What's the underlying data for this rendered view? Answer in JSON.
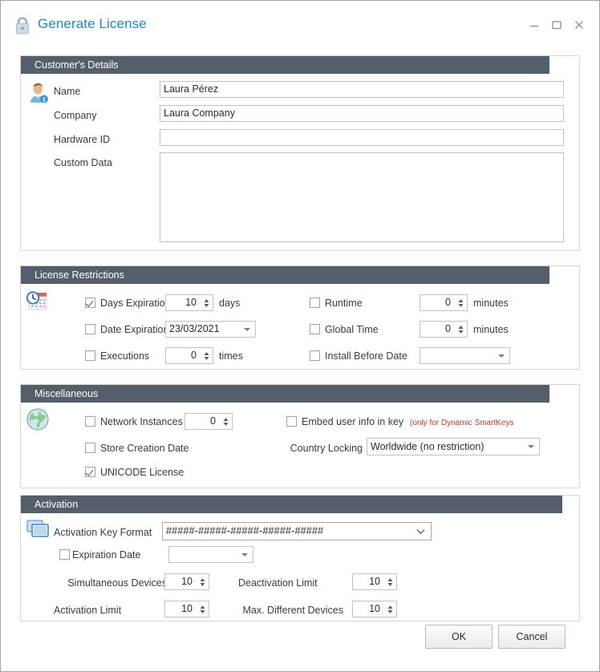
{
  "window": {
    "title": "Generate License",
    "icon": "lock-icon",
    "controls": {
      "minimize": "minimize-icon",
      "maximize": "maximize-icon",
      "close": "close-icon"
    }
  },
  "customer_details": {
    "header": "Customer's Details",
    "icon": "user-info-icon",
    "fields": [
      {
        "label": "Name",
        "value": "Laura Pérez"
      },
      {
        "label": "Company",
        "value": "Laura Company"
      },
      {
        "label": "Hardware ID",
        "value": ""
      },
      {
        "label": "Custom Data",
        "value": ""
      }
    ]
  },
  "license_restrictions": {
    "header": "License Restrictions",
    "icon": "calendar-clock-icon",
    "left": [
      {
        "label": "Days Expiration",
        "checked": true,
        "value": "10",
        "unit": "days",
        "control": "spinner"
      },
      {
        "label": "Date Expiration",
        "checked": false,
        "value": "23/03/2021",
        "unit": "",
        "control": "datepicker"
      },
      {
        "label": "Executions",
        "checked": false,
        "value": "0",
        "unit": "times",
        "control": "spinner"
      }
    ],
    "right": [
      {
        "label": "Runtime",
        "checked": false,
        "value": "0",
        "unit": "minutes",
        "control": "spinner"
      },
      {
        "label": "Global Time",
        "checked": false,
        "value": "0",
        "unit": "minutes",
        "control": "spinner"
      },
      {
        "label": "Install Before Date",
        "checked": false,
        "value": "",
        "unit": "",
        "control": "datepicker"
      }
    ]
  },
  "miscellaneous": {
    "header": "Miscellaneous",
    "icon": "globe-icon",
    "network_instances": {
      "label": "Network Instances",
      "checked": false,
      "value": "0"
    },
    "store_creation_date": {
      "label": "Store Creation Date",
      "checked": false
    },
    "unicode_license": {
      "label": "UNICODE License",
      "checked": true
    },
    "embed_user_info": {
      "label": "Embed user info in key",
      "checked": false,
      "note": "(only for Dynamic SmartKeys"
    },
    "country_locking": {
      "label": "Country Locking",
      "value": "Worldwide (no restriction)"
    }
  },
  "activation": {
    "header": "Activation",
    "icon": "two-screens-icon",
    "key_format": {
      "label": "Activation Key Format",
      "value": "#####-#####-#####-#####-#####"
    },
    "expiration_date": {
      "label": "Expiration Date",
      "checked": false,
      "value": ""
    },
    "simultaneous_devices": {
      "label": "Simultaneous Devices",
      "value": "10"
    },
    "activation_limit": {
      "label": "Activation Limit",
      "value": "10"
    },
    "deactivation_limit": {
      "label": "Deactivation Limit",
      "value": "10"
    },
    "max_different_devices": {
      "label": "Max. Different Devices",
      "value": "10"
    }
  },
  "footer": {
    "ok": "OK",
    "cancel": "Cancel"
  },
  "colors": {
    "header_bar": "#555f6b",
    "title_text": "#1e87c8",
    "note_red": "#c0392b"
  }
}
